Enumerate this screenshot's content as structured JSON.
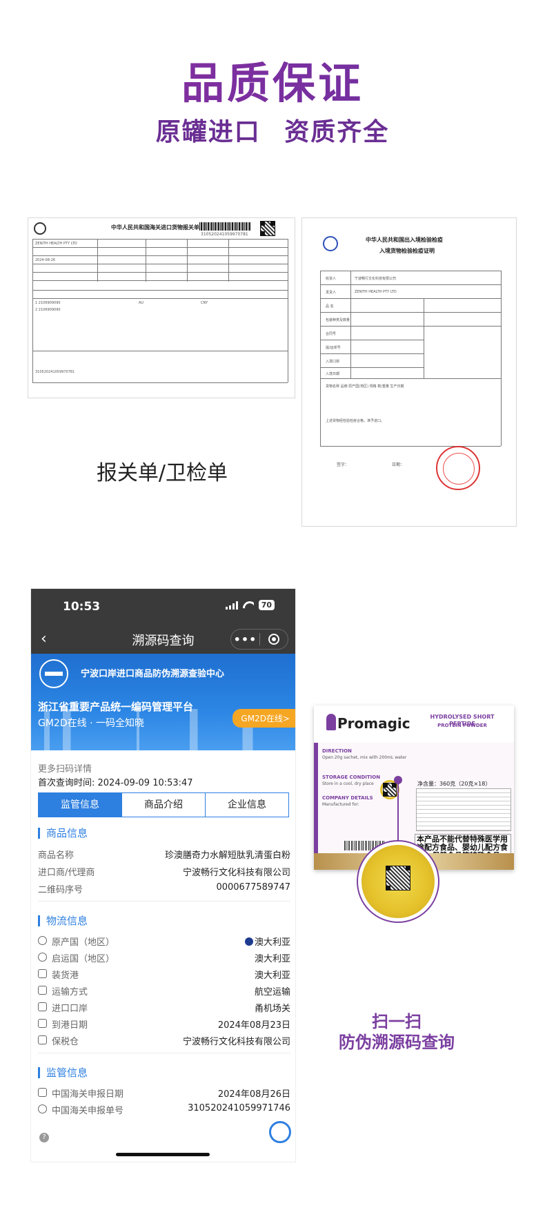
{
  "hero": {
    "title": "品质保证",
    "subtitle": "原罐进口  资质齐全"
  },
  "documents": {
    "customs_form_title": "中华人民共和国海关进口货物报关单",
    "customs_form_number": "310520241059970781",
    "inspection_title": "中华人民共和国出入境检验检疫",
    "inspection_subtitle": "入境货物检验检疫证明",
    "caption": "报关单/卫检单"
  },
  "phone": {
    "status": {
      "time": "10:53",
      "battery": "70"
    },
    "nav": {
      "title": "溯源码查询",
      "more": "•••"
    },
    "banner": {
      "org": "宁波口岸进口商品防伪溯源查验中心",
      "platform": "浙江省重要产品统一编码管理平台",
      "slogan": "GM2D在线 · 一码全知晓",
      "button": "GM2D在线>"
    },
    "scan_more": "更多扫码详情",
    "first_query": "首次查询时间: 2024-09-09 10:53:47",
    "tabs": [
      "监管信息",
      "商品介绍",
      "企业信息"
    ],
    "product_section": {
      "title": "商品信息",
      "rows": [
        {
          "k": "商品名称",
          "v": "珍澳膳奇力水解短肽乳清蛋白粉"
        },
        {
          "k": "进口商/代理商",
          "v": "宁波畅行文化科技有限公司"
        },
        {
          "k": "二维码序号",
          "v": "0000677589747"
        }
      ]
    },
    "logistics_section": {
      "title": "物流信息",
      "rows": [
        {
          "k": "原产国（地区）",
          "v": "澳大利亚"
        },
        {
          "k": "启运国（地区）",
          "v": "澳大利亚"
        },
        {
          "k": "装货港",
          "v": "澳大利亚"
        },
        {
          "k": "运输方式",
          "v": "航空运输"
        },
        {
          "k": "进口口岸",
          "v": "甬机场关"
        },
        {
          "k": "到港日期",
          "v": "2024年08月23日"
        },
        {
          "k": "保税仓",
          "v": "宁波畅行文化科技有限公司"
        }
      ]
    },
    "supervision_section": {
      "title": "监管信息",
      "rows": [
        {
          "k": "中国海关申报日期",
          "v": "2024年08月26日"
        },
        {
          "k": "中国海关申报单号",
          "v": "310520241059971746"
        }
      ]
    }
  },
  "product": {
    "brand": "Promagic",
    "tag_line1": "HYDROLYSED SHORT PEPTIDE",
    "tag_line2": "PROTEIN POWDER",
    "direction": "DIRECTION",
    "storage": "STORAGE CONDITION",
    "company": "COMPANY DETAILS",
    "net_weight": "净含量：360克（20克×18）",
    "notice": "本产品不能代替特殊医学用途配方食品、婴幼儿配方食品、保健食品等特殊食品"
  },
  "scan": {
    "title": "扫一扫",
    "subtitle": "防伪溯源码查询"
  },
  "colors": {
    "purple": "#7b3fa0",
    "blue": "#2d7fe0",
    "orange": "#f5a623"
  }
}
